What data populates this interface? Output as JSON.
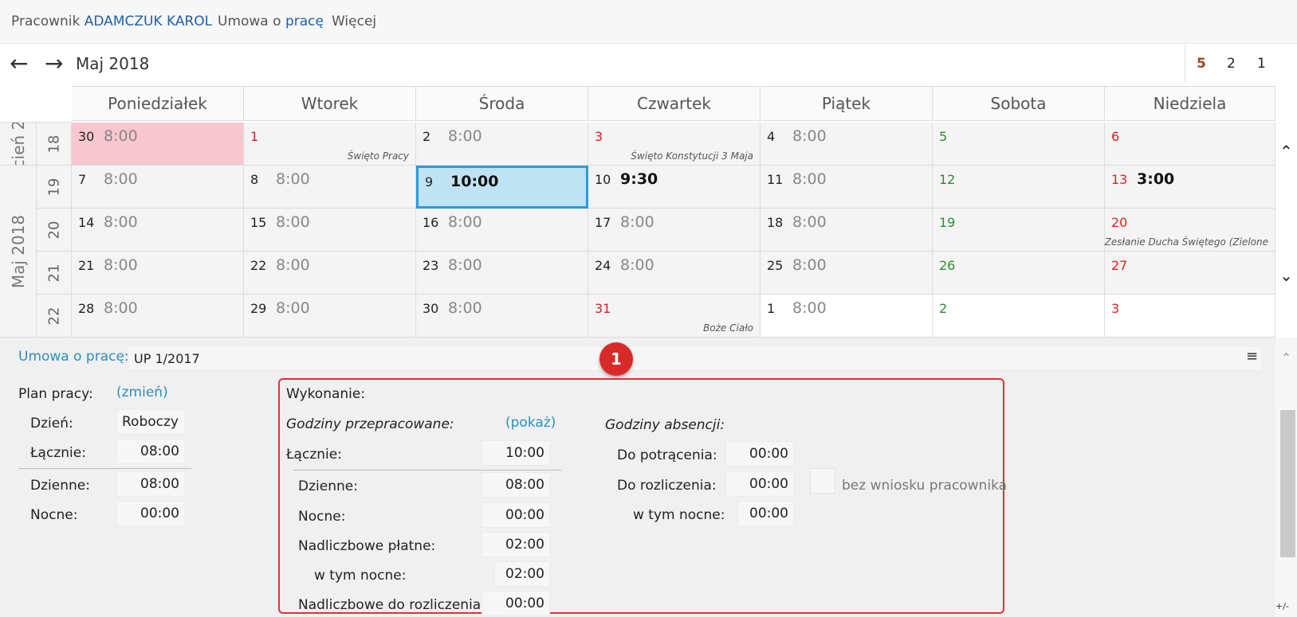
{
  "breadcrumb": {
    "employee_prefix": "Pracownik",
    "employee_name": "ADAMCZUK KAROL",
    "contract_prefix": "Umowa o",
    "contract_link": "pracę",
    "more": "Więcej"
  },
  "nav": {
    "prev_icon": "←",
    "next_icon": "→",
    "month_title": "Maj 2018",
    "view_options": [
      "5",
      "2",
      "1"
    ],
    "active_view": "5"
  },
  "calendar": {
    "days": [
      "Poniedziałek",
      "Wtorek",
      "Środa",
      "Czwartek",
      "Piątek",
      "Sobota",
      "Niedziela"
    ],
    "prev_month_label": "cień 2",
    "month_label": "Maj 2018",
    "weeks": [
      {
        "num": "18",
        "cells": [
          {
            "d": "30",
            "h": "8:00",
            "style": "pink"
          },
          {
            "d": "1",
            "h": "",
            "color": "red",
            "note": "Święto Pracy"
          },
          {
            "d": "2",
            "h": "8:00"
          },
          {
            "d": "3",
            "h": "",
            "color": "red",
            "note": "Święto Konstytucji 3 Maja"
          },
          {
            "d": "4",
            "h": "8:00"
          },
          {
            "d": "5",
            "h": "",
            "color": "green"
          },
          {
            "d": "6",
            "h": "",
            "color": "red"
          }
        ]
      },
      {
        "num": "19",
        "cells": [
          {
            "d": "7",
            "h": "8:00"
          },
          {
            "d": "8",
            "h": "8:00"
          },
          {
            "d": "9",
            "h": "10:00",
            "bold": true,
            "style": "sel"
          },
          {
            "d": "10",
            "h": "9:30",
            "bold": true
          },
          {
            "d": "11",
            "h": "8:00"
          },
          {
            "d": "12",
            "h": "",
            "color": "green"
          },
          {
            "d": "13",
            "h": "3:00",
            "bold": true,
            "color": "red"
          }
        ]
      },
      {
        "num": "20",
        "cells": [
          {
            "d": "14",
            "h": "8:00"
          },
          {
            "d": "15",
            "h": "8:00"
          },
          {
            "d": "16",
            "h": "8:00"
          },
          {
            "d": "17",
            "h": "8:00"
          },
          {
            "d": "18",
            "h": "8:00"
          },
          {
            "d": "19",
            "h": "",
            "color": "green"
          },
          {
            "d": "20",
            "h": "",
            "color": "red",
            "note": "Zesłanie Ducha Świętego (Zielone"
          }
        ]
      },
      {
        "num": "21",
        "cells": [
          {
            "d": "21",
            "h": "8:00"
          },
          {
            "d": "22",
            "h": "8:00"
          },
          {
            "d": "23",
            "h": "8:00"
          },
          {
            "d": "24",
            "h": "8:00"
          },
          {
            "d": "25",
            "h": "8:00"
          },
          {
            "d": "26",
            "h": "",
            "color": "green"
          },
          {
            "d": "27",
            "h": "",
            "color": "red"
          }
        ]
      },
      {
        "num": "22",
        "cells": [
          {
            "d": "28",
            "h": "8:00"
          },
          {
            "d": "29",
            "h": "8:00"
          },
          {
            "d": "30",
            "h": "8:00"
          },
          {
            "d": "31",
            "h": "",
            "color": "red",
            "note": "Boże Ciało"
          },
          {
            "d": "1",
            "h": "8:00",
            "style": "white"
          },
          {
            "d": "2",
            "h": "",
            "color": "green",
            "style": "white"
          },
          {
            "d": "3",
            "h": "",
            "color": "red",
            "style": "white"
          }
        ]
      }
    ]
  },
  "contract": {
    "label": "Umowa o pracę:",
    "value": "UP 1/2017",
    "menu_icon": "≡"
  },
  "badge": "1",
  "plan": {
    "title": "Plan pracy:",
    "change_link": "(zmień)",
    "day_label": "Dzień:",
    "day_value": "Roboczy",
    "total_label": "Łącznie:",
    "total_value": "08:00",
    "daily_label": "Dzienne:",
    "daily_value": "08:00",
    "night_label": "Nocne:",
    "night_value": "00:00"
  },
  "execution": {
    "title": "Wykonanie:",
    "worked_title": "Godziny przepracowane:",
    "show_link": "(pokaż)",
    "total_label": "Łącznie:",
    "total_value": "10:00",
    "daily_label": "Dzienne:",
    "daily_value": "08:00",
    "night_label": "Nocne:",
    "night_value": "00:00",
    "overtime_paid_label": "Nadliczbowe płatne:",
    "overtime_paid_value": "02:00",
    "overtime_night_label": "w tym nocne:",
    "overtime_night_value": "02:00",
    "overtime_settle_label": "Nadliczbowe do rozliczenia:",
    "overtime_settle_value": "00:00",
    "absence_title": "Godziny absencji:",
    "deduct_label": "Do potrącenia:",
    "deduct_value": "00:00",
    "settle_label": "Do rozliczenia:",
    "settle_value": "00:00",
    "without_request": "bez wniosku pracownika",
    "settle_night_label": "w tym nocne:",
    "settle_night_value": "00:00"
  },
  "scroll": {
    "up_icon": "⌃",
    "down_icon": "⌄",
    "corner": "+/-"
  }
}
